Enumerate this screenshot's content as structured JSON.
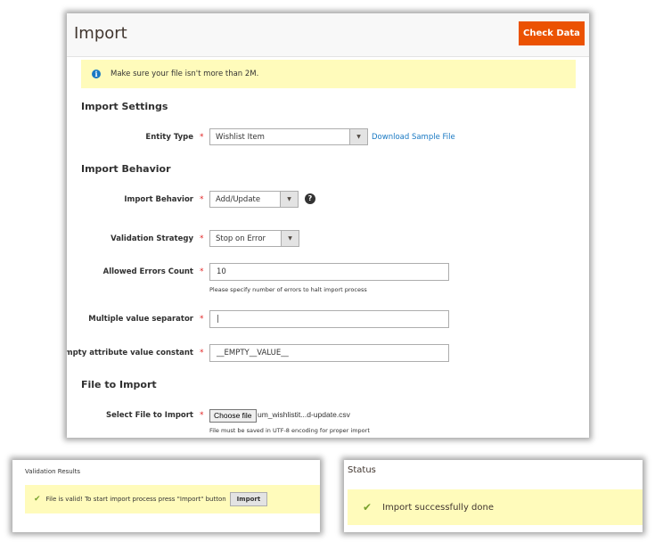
{
  "header": {
    "title": "Import",
    "check_data_label": "Check Data"
  },
  "notice": {
    "icon": "info-icon",
    "text": "Make sure your file isn't more than 2M."
  },
  "import_settings": {
    "section_title": "Import Settings",
    "entity_type": {
      "label": "Entity Type",
      "value": "Wishlist Item",
      "link_label": "Download Sample File"
    }
  },
  "import_behavior": {
    "section_title": "Import Behavior",
    "behavior": {
      "label": "Import Behavior",
      "value": "Add/Update",
      "help_icon": "?"
    },
    "validation_strategy": {
      "label": "Validation Strategy",
      "value": "Stop on Error"
    },
    "allowed_errors": {
      "label": "Allowed Errors Count",
      "value": "10",
      "note": "Please specify number of errors to halt import process"
    },
    "separator": {
      "label": "Multiple value separator",
      "value": "|"
    },
    "empty_constant": {
      "label": "Empty attribute value constant",
      "value": "__EMPTY__VALUE__"
    }
  },
  "file_to_import": {
    "section_title": "File to Import",
    "select_file": {
      "label": "Select File to Import",
      "button_label": "Choose file",
      "file_name": "um_wishlistit...d-update.csv",
      "note": "File must be saved in UTF-8 encoding for proper import"
    }
  },
  "required_mark": "*",
  "dropdown_arrow": "▼",
  "validation_results": {
    "title": "Validation Results",
    "message": "File is valid! To start import process press \"Import\" button",
    "import_button_label": "Import",
    "check_icon": "✔"
  },
  "status": {
    "title": "Status",
    "message": "Import successfully done",
    "check_icon": "✔"
  },
  "colors": {
    "accent": "#eb5202",
    "notice_bg": "#fffbbb",
    "link": "#1979c3",
    "success": "#79a22e",
    "required": "#e22626"
  }
}
